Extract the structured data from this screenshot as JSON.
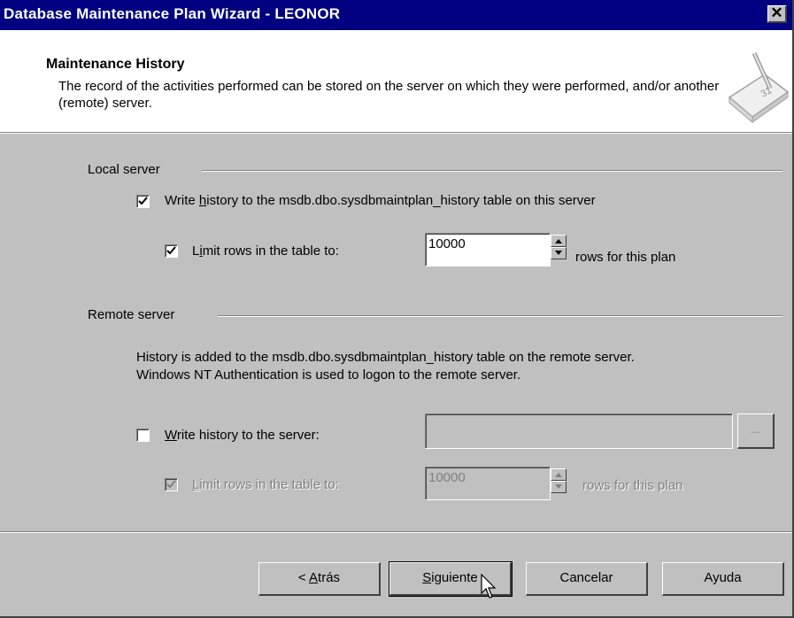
{
  "window": {
    "title": "Database Maintenance Plan Wizard - LEONOR",
    "close_glyph": "✕"
  },
  "header": {
    "title": "Maintenance History",
    "description": "The record of the activities performed can be stored on the server on which they were performed, and/or another (remote) server."
  },
  "local": {
    "group_label": "Local server",
    "write_history_pre": "Write ",
    "write_history_u": "h",
    "write_history_post": "istory to the msdb.dbo.sysdbmaintplan_history table on this server",
    "write_history_checked": true,
    "limit_pre": "L",
    "limit_u": "i",
    "limit_post": "mit rows in the table to:",
    "limit_checked": true,
    "rows_value": "10000",
    "rows_suffix": "rows for this plan"
  },
  "remote": {
    "group_label": "Remote server",
    "info_line1": "History is added to the msdb.dbo.sysdbmaintplan_history table on the remote server.",
    "info_line2": "Windows NT Authentication is used to logon to the remote server.",
    "write_u": "W",
    "write_post": "rite history to the server:",
    "write_checked": false,
    "server_value": "",
    "browse_label": "...",
    "limit_u": "L",
    "limit_post": "imit rows in the table to:",
    "limit_checked": true,
    "rows_value": "10000",
    "rows_suffix": "rows for this plan"
  },
  "buttons": {
    "back_pre": "< ",
    "back_u": "A",
    "back_post": "trás",
    "next_u": "S",
    "next_post": "iguiente",
    "cancel": "Cancelar",
    "help": "Ayuda"
  }
}
